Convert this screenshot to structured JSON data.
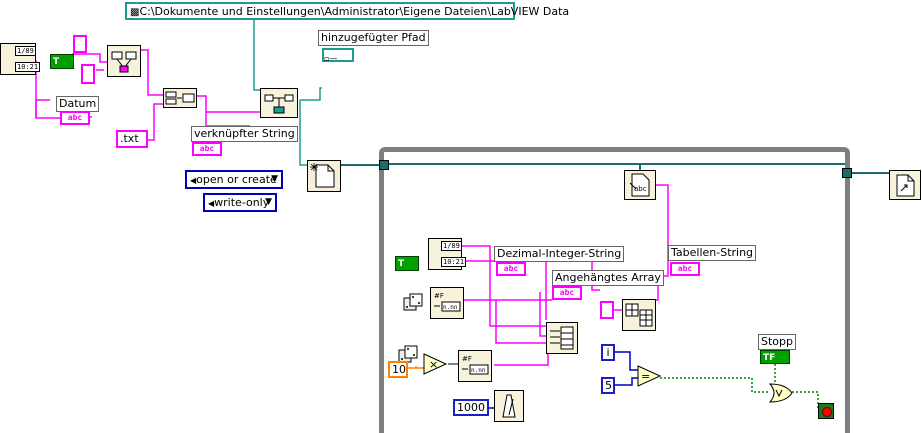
{
  "path_constant": "C:\\Dokumente und Einstellungen\\Administrator\\Eigene Dateien\\LabVIEW Data",
  "labels": {
    "datum": "Datum",
    "hinzugefuegter_pfad": "hinzugefügter Pfad",
    "verknuepfter_string": "verknüpfter String",
    "dezimal_integer_string": "Dezimal-Integer-String",
    "angehaengtes_array": "Angehängtes Array",
    "tabellen_string": "Tabellen-String",
    "stopp": "Stopp"
  },
  "constants": {
    "txt": ".txt",
    "open_or_create": "open or create",
    "write_only": "write-only",
    "ten": "10",
    "five": "5",
    "thousand": "1000",
    "loop_index": "i"
  },
  "glyphs": {
    "abc": "abc",
    "date_top": "1/89",
    "date_bottom": "10:21",
    "tf": "TF",
    "tf_short": "T",
    "enum_arrow": "▼",
    "multiply": "×",
    "equals": "=",
    "or": "OR"
  },
  "colors": {
    "string_wire": "#ff00ff",
    "path_wire": "#1d9b91",
    "bool_wire": "#008000",
    "int_wire": "#0000c0",
    "dbl_wire": "#ff7f00",
    "loop_frame": "#7f7f7f"
  },
  "icons": [
    "date-time-icon",
    "build-path-icon",
    "concatenate-strings-icon",
    "open-create-replace-file-icon",
    "write-to-text-file-icon",
    "close-file-icon",
    "random-number-icon",
    "format-into-string-icon",
    "array-to-spreadsheet-string-icon",
    "wait-ms-icon",
    "multiply-icon",
    "equal-icon",
    "or-icon",
    "stop-terminal-icon"
  ]
}
